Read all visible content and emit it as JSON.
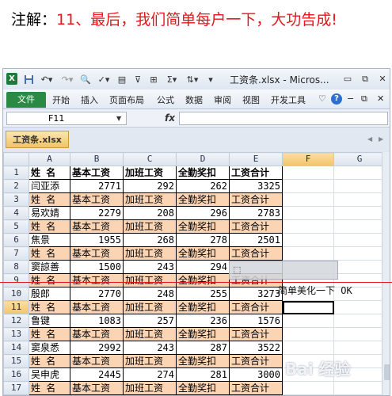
{
  "instruction": {
    "label": "注解：",
    "text": "11、最后，我们简单每户一下，大功告成!"
  },
  "window": {
    "title": "工资条.xlsx - Micros...",
    "icon": "excel-icon",
    "quick_access": [
      "save-icon",
      "undo-icon",
      "redo-icon",
      "print-preview-icon",
      "spelling-icon",
      "paste-icon",
      "filter-icon",
      "border-icon",
      "sum-icon",
      "sort-icon"
    ]
  },
  "ribbon": {
    "file": "文件",
    "tabs": [
      "开始",
      "插入",
      "页面布局",
      "公式",
      "数据",
      "审阅",
      "视图",
      "开发工具"
    ]
  },
  "formula_bar": {
    "name_box": "F11",
    "fx": "fx",
    "formula": ""
  },
  "workbook_tab": "工资条.xlsx",
  "sheet": {
    "columns": [
      "A",
      "B",
      "C",
      "D",
      "E",
      "F",
      "G"
    ],
    "rows": [
      {
        "n": "1",
        "kind": "hdr1",
        "cells": [
          "姓 名",
          "基本工资",
          "加班工资",
          "全勤奖扣",
          "工资合计"
        ]
      },
      {
        "n": "2",
        "kind": "data",
        "cells": [
          "闫亚添",
          "2771",
          "292",
          "262",
          "3325"
        ]
      },
      {
        "n": "3",
        "kind": "hdr",
        "cells": [
          "姓 名",
          "基本工资",
          "加班工资",
          "全勤奖扣",
          "工资合计"
        ]
      },
      {
        "n": "4",
        "kind": "data",
        "cells": [
          "易欢婧",
          "2279",
          "208",
          "296",
          "2783"
        ]
      },
      {
        "n": "5",
        "kind": "hdr",
        "cells": [
          "姓 名",
          "基本工资",
          "加班工资",
          "全勤奖扣",
          "工资合计"
        ]
      },
      {
        "n": "6",
        "kind": "data",
        "cells": [
          "焦景",
          "1955",
          "268",
          "278",
          "2501"
        ]
      },
      {
        "n": "7",
        "kind": "hdr",
        "cells": [
          "姓 名",
          "基本工资",
          "加班工资",
          "全勤奖扣",
          "工资合计"
        ]
      },
      {
        "n": "8",
        "kind": "data",
        "cells": [
          "窦諒善",
          "1500",
          "243",
          "294",
          ""
        ]
      },
      {
        "n": "9",
        "kind": "hdr",
        "cells": [
          "姓 名",
          "基本工资",
          "加班工资",
          "全勤奖扣",
          "工资合计"
        ]
      },
      {
        "n": "10",
        "kind": "data",
        "cells": [
          "殷郎",
          "2770",
          "248",
          "255",
          "3273"
        ]
      },
      {
        "n": "11",
        "kind": "hdr",
        "cells": [
          "姓 名",
          "基本工资",
          "加班工资",
          "全勤奖扣",
          "工资合计"
        ]
      },
      {
        "n": "12",
        "kind": "data",
        "cells": [
          "鲁键",
          "1083",
          "257",
          "236",
          "1576"
        ]
      },
      {
        "n": "13",
        "kind": "hdr",
        "cells": [
          "姓 名",
          "基本工资",
          "加班工资",
          "全勤奖扣",
          "工资合计"
        ]
      },
      {
        "n": "14",
        "kind": "data",
        "cells": [
          "窦泉悉",
          "2992",
          "243",
          "287",
          "3522"
        ]
      },
      {
        "n": "15",
        "kind": "hdr",
        "cells": [
          "姓 名",
          "基本工资",
          "加班工资",
          "全勤奖扣",
          "工资合计"
        ]
      },
      {
        "n": "16",
        "kind": "data",
        "cells": [
          "吴申虎",
          "2445",
          "274",
          "281",
          "3000"
        ]
      },
      {
        "n": "17",
        "kind": "hdr",
        "cells": [
          "姓 名",
          "基本工资",
          "加班工资",
          "全勤奖扣",
          "工资合计"
        ]
      }
    ],
    "selected_row": "11",
    "selected_col": "F",
    "ok_note": "简单美化一下 OK"
  },
  "watermark": "Bai 经验",
  "colors": {
    "header_fill": "#fbd4b4",
    "accent_red": "#e8151b",
    "file_tab": "#2a8a43"
  }
}
